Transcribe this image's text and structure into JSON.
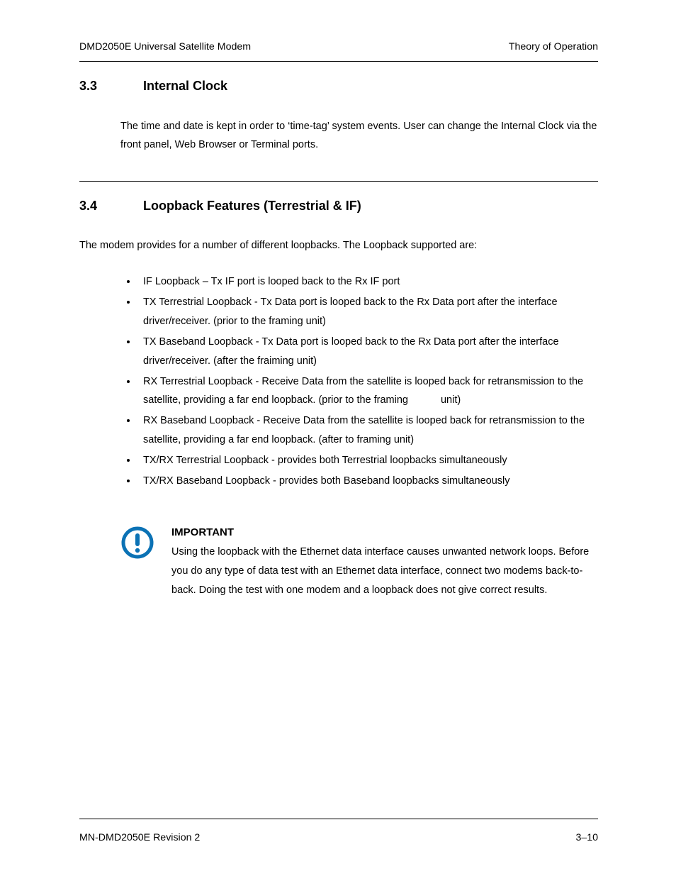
{
  "header": {
    "left": "DMD2050E Universal Satellite Modem",
    "right": "Theory of Operation"
  },
  "section33": {
    "num": "3.3",
    "title": "Internal Clock",
    "para": "The time and date is kept in order to ‘time-tag’ system events.  User can change the Internal Clock via the front panel, Web Browser or Terminal ports."
  },
  "section34": {
    "num": "3.4",
    "title": "Loopback Features (Terrestrial & IF)",
    "intro": "The modem provides for a number of different loopbacks.  The Loopback supported are:",
    "bullets": [
      "IF Loopback – Tx IF port is looped back to the Rx IF port",
      "TX Terrestrial Loopback - Tx Data port is looped back to the Rx Data port after the interface driver/receiver.  (prior to the framing unit)",
      "TX Baseband Loopback - Tx Data port is looped back to the Rx Data port after the interface driver/receiver.  (after the fraiming unit)",
      "RX Terrestrial Loopback - Receive Data from the satellite is looped back for retransmission to the satellite, providing a far end loopback.  (prior to the framing",
      "RX Baseband Loopback - Receive Data from the satellite is looped back for retransmission to the satellite, providing a far end loopback.  (after to framing unit)",
      "TX/RX Terrestrial Loopback - provides both Terrestrial loopbacks simultaneously",
      "TX/RX Baseband Loopback - provides both Baseband loopbacks simultaneously"
    ],
    "bullet4_tail": "unit)"
  },
  "important": {
    "label": "IMPORTANT",
    "text": "Using the loopback with the Ethernet data interface causes unwanted network loops.  Before you do any type of data test with an Ethernet data interface, connect two modems back-to-back.  Doing the test with one modem and a loopback does not give correct results."
  },
  "footer": {
    "left": "MN-DMD2050E   Revision 2",
    "right": "3–10"
  },
  "icons": {
    "important": "exclamation-circle-icon"
  }
}
